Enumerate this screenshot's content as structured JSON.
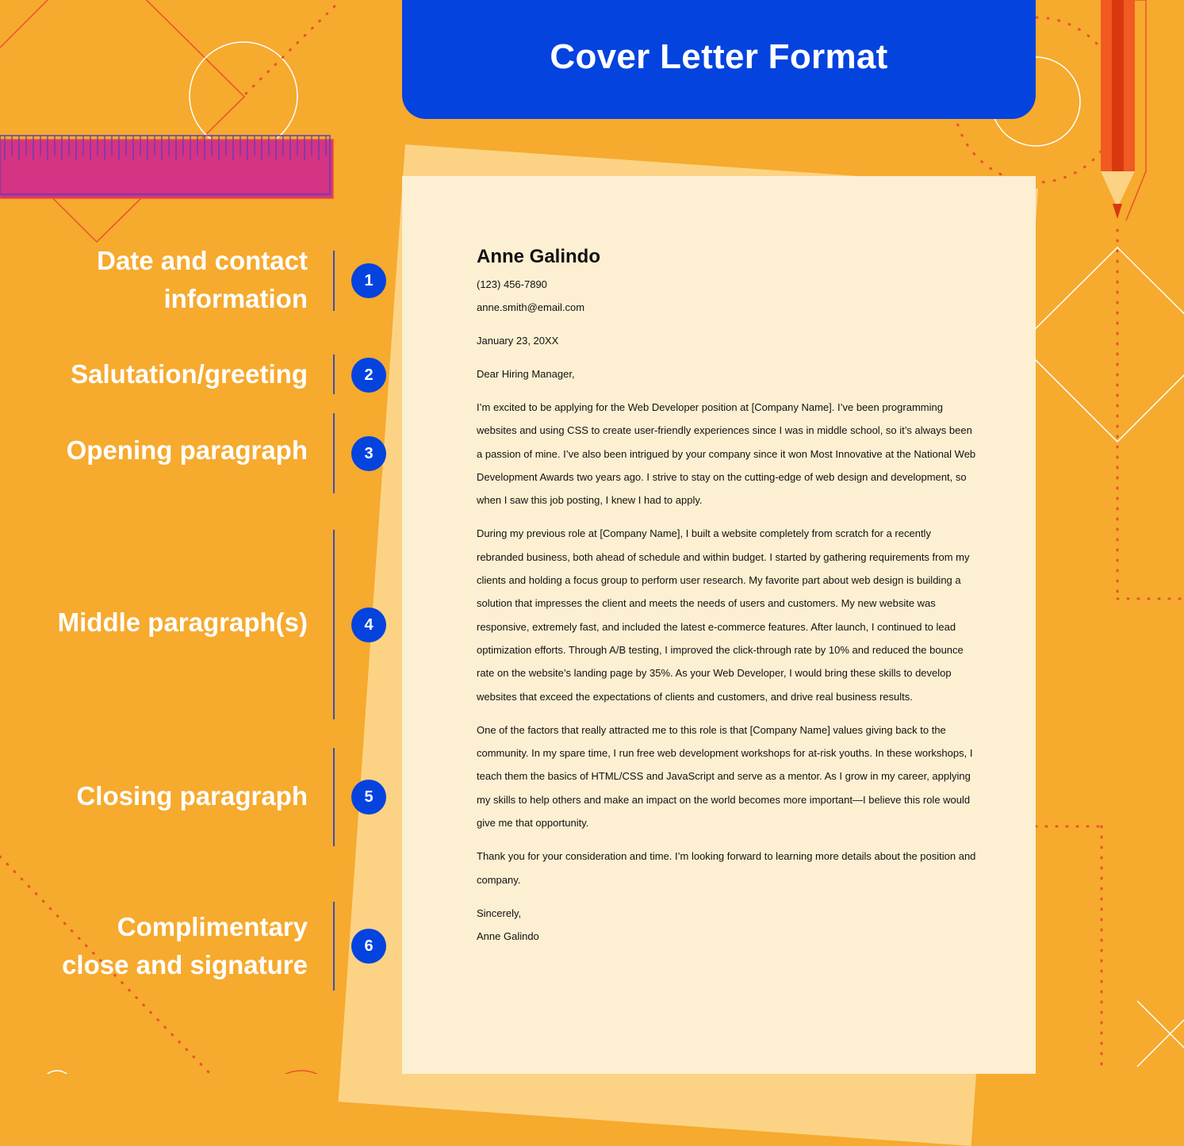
{
  "header": {
    "title": "Cover Letter Format"
  },
  "sections": [
    {
      "number": "1",
      "label_lines": [
        "Date and contact",
        "information"
      ]
    },
    {
      "number": "2",
      "label_lines": [
        "Salutation/greeting"
      ]
    },
    {
      "number": "3",
      "label_lines": [
        "Opening paragraph"
      ]
    },
    {
      "number": "4",
      "label_lines": [
        "Middle paragraph(s)"
      ]
    },
    {
      "number": "5",
      "label_lines": [
        "Closing paragraph"
      ]
    },
    {
      "number": "6",
      "label_lines": [
        "Complimentary",
        "close and signature"
      ]
    }
  ],
  "letter": {
    "name": "Anne Galindo",
    "phone": "(123) 456-7890",
    "email": "anne.smith@email.com",
    "date": "January 23, 20XX",
    "greeting": "Dear Hiring Manager,",
    "opening": "I’m excited to be applying for the Web Developer position at [Company Name]. I’ve been programming websites and using CSS to create user-friendly experiences since I was in middle school, so it’s always been a passion of mine. I’ve also been intrigued by your company since it won Most Innovative at the National Web Development Awards two years ago. I strive to stay on the cutting-edge of web design and development, so when I saw this job posting, I knew I had to apply.",
    "middle": "During my previous role at [Company Name], I built a website completely from scratch for a recently rebranded business, both ahead of schedule and within budget. I started by gathering requirements from my clients and holding a focus group to perform user research. My favorite part about web design is building a solution that impresses the client and meets the needs of users and customers. My new website was responsive, extremely fast, and included the latest e-commerce features. After launch, I continued to lead optimization efforts. Through A/B testing, I improved the click-through rate by 10% and reduced the bounce rate on the website’s landing page by 35%. As your Web Developer, I would bring these skills to develop websites that exceed the expectations of clients and customers, and drive real business results.",
    "closing_1": "One of the factors that really attracted me to this role is that [Company Name] values giving back to the community. In my spare time, I run free web development workshops for at-risk youths. In these workshops, I teach them the basics of HTML/CSS and JavaScript and serve as a mentor. As I grow in my career, applying my skills to help others and make an impact on the world becomes more important—I believe this role would give me that opportunity.",
    "closing_2": "Thank you for your consideration and time. I’m looking forward to learning more details about the position and company.",
    "sign_off": "Sincerely,",
    "signature": "Anne Galindo"
  },
  "colors": {
    "background": "#F6AA2E",
    "banner": "#0443DE",
    "paper": "#FDEFD2",
    "paper_back": "#FCD385",
    "ruler": "#D53384",
    "pencil": "#F15A22"
  },
  "icons": [
    "ruler-icon",
    "pencil-icon"
  ]
}
